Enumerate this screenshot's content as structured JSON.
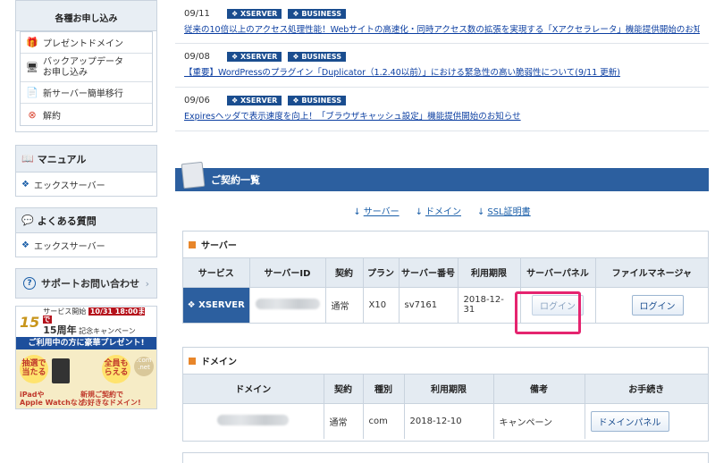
{
  "sidebar": {
    "apply_title": "各種お申し込み",
    "apply_items": [
      {
        "label": "プレゼントドメイン",
        "icon": "gift-icon"
      },
      {
        "label": "バックアップデータ\nお申し込み",
        "icon": "server-icon"
      },
      {
        "label": "新サーバー簡単移行",
        "icon": "document-icon"
      },
      {
        "label": "解約",
        "icon": "cancel-icon"
      }
    ],
    "manual_title": "マニュアル",
    "manual_item": "エックスサーバー",
    "faq_title": "よくある質問",
    "faq_item": "エックスサーバー",
    "support_title": "サポートお問い合わせ",
    "banner": {
      "years": "15",
      "line1": "サービス開始",
      "date": "10/31 18:00まで",
      "line2": "15周年",
      "line3": "記念キャンペーン",
      "mid": "ご利用中の方に豪華プレゼント!",
      "c1": "抽選で当たる",
      "c2": "全員もらえる",
      "l1": "iPadや\nApple Watchなど",
      "l2": "新規ご契約で\nお好きなドメイン!",
      "com": ".com",
      "net": ".net"
    }
  },
  "news": [
    {
      "date": "09/11",
      "tags": [
        "XSERVER",
        "BUSINESS"
      ],
      "text": "従来の10倍以上のアクセス処理性能！Webサイトの高速化・同時アクセス数の拡張を実現する「Xアクセラレータ」機能提供開始のお知ら"
    },
    {
      "date": "09/08",
      "tags": [
        "XSERVER",
        "BUSINESS"
      ],
      "text": "【重要】WordPressのプラグイン「Duplicator（1.2.40以前）」における緊急性の高い脆弱性について(9/11 更新)"
    },
    {
      "date": "09/06",
      "tags": [
        "XSERVER",
        "BUSINESS"
      ],
      "text": "Expiresヘッダで表示速度を向上！「ブラウザキャッシュ設定」機能提供開始のお知らせ"
    }
  ],
  "contracts": {
    "title": "ご契約一覧",
    "anchors": [
      "サーバー",
      "ドメイン",
      "SSL証明書"
    ],
    "server": {
      "heading": "サーバー",
      "columns": [
        "サービス",
        "サーバーID",
        "契約",
        "プラン",
        "サーバー番号",
        "利用期限",
        "サーバーパネル",
        "ファイルマネージャ"
      ],
      "row": {
        "service": "XSERVER",
        "contract": "通常",
        "plan": "X10",
        "number": "sv7161",
        "expiry": "2018-12-31",
        "panel_btn": "ログイン",
        "fm_btn": "ログイン"
      }
    },
    "domain": {
      "heading": "ドメイン",
      "columns": [
        "ドメイン",
        "契約",
        "種別",
        "利用期限",
        "備考",
        "お手続き"
      ],
      "row": {
        "contract": "通常",
        "type": "com",
        "expiry": "2018-12-10",
        "note": "キャンペーン",
        "btn": "ドメインパネル"
      }
    }
  },
  "colors": {
    "accent": "#2c5f9f",
    "highlight": "#e5246f",
    "tag": "#1a4d8f",
    "link": "#0b3ea1"
  }
}
